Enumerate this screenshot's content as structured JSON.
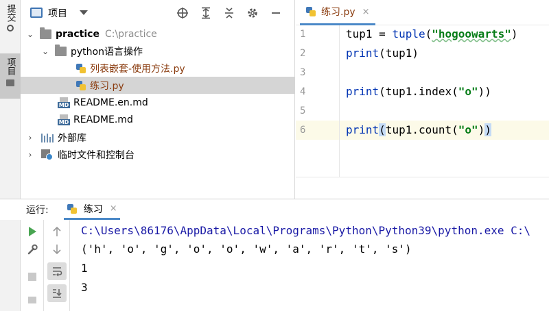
{
  "left_strip": {
    "commit_label": "提交",
    "project_label": "项目"
  },
  "project_panel": {
    "title": "项目",
    "toolbar": [
      "locate",
      "expand",
      "collapse",
      "settings",
      "hide"
    ],
    "tree": {
      "root_name": "practice",
      "root_path": "C:\\practice",
      "folder": "python语言操作",
      "file1": "列表嵌套-使用方法.py",
      "file2": "练习.py",
      "readme_en": "README.en.md",
      "readme": "README.md",
      "external_libs": "外部库",
      "scratches": "临时文件和控制台",
      "md_tag": "MD"
    }
  },
  "editor": {
    "tab_label": "练习.py",
    "tab_close": "×",
    "line_numbers": [
      "1",
      "2",
      "3",
      "4",
      "5",
      "6"
    ],
    "code": {
      "l1_var": "tup1 = ",
      "l1_fn": "tuple",
      "l1_open": "(",
      "l1_str": "\"hogoowarts\"",
      "l1_close": ")",
      "l2_fn": "print",
      "l2_rest": "(tup1)",
      "l4_fn": "print",
      "l4_mid": "(tup1.index(",
      "l4_str": "\"o\"",
      "l4_close": "))",
      "l6_fn": "print",
      "l6_open": "(",
      "l6_mid": "tup1.count(",
      "l6_str": "\"o\"",
      "l6_close1": ")",
      "l6_close2": ")"
    }
  },
  "run_panel": {
    "label": "运行:",
    "tab_label": "练习",
    "tab_close": "×",
    "output": [
      "C:\\Users\\86176\\AppData\\Local\\Programs\\Python\\Python39\\python.exe C:\\",
      "('h', 'o', 'g', 'o', 'o', 'w', 'a', 'r', 't', 's')",
      "1",
      "3"
    ]
  }
}
